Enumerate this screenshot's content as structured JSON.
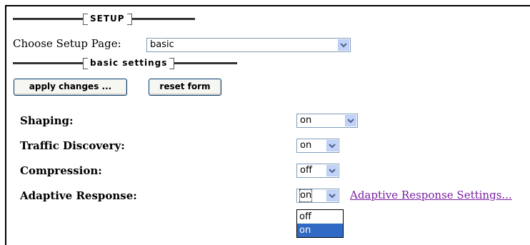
{
  "setup_header": "SETUP",
  "choose_page": {
    "label": "Choose Setup Page:",
    "value": "basic"
  },
  "section_header": "basic settings",
  "buttons": {
    "apply": "apply changes ...",
    "reset": "reset form"
  },
  "settings": [
    {
      "label": "Shaping:",
      "value": "on"
    },
    {
      "label": "Traffic Discovery:",
      "value": "on"
    },
    {
      "label": "Compression:",
      "value": "off"
    },
    {
      "label": "Adaptive Response:",
      "value": "on"
    }
  ],
  "adaptive_link": "Adaptive Response Settings...",
  "adaptive_dropdown": {
    "options": [
      "off",
      "on"
    ],
    "highlighted": "on"
  }
}
